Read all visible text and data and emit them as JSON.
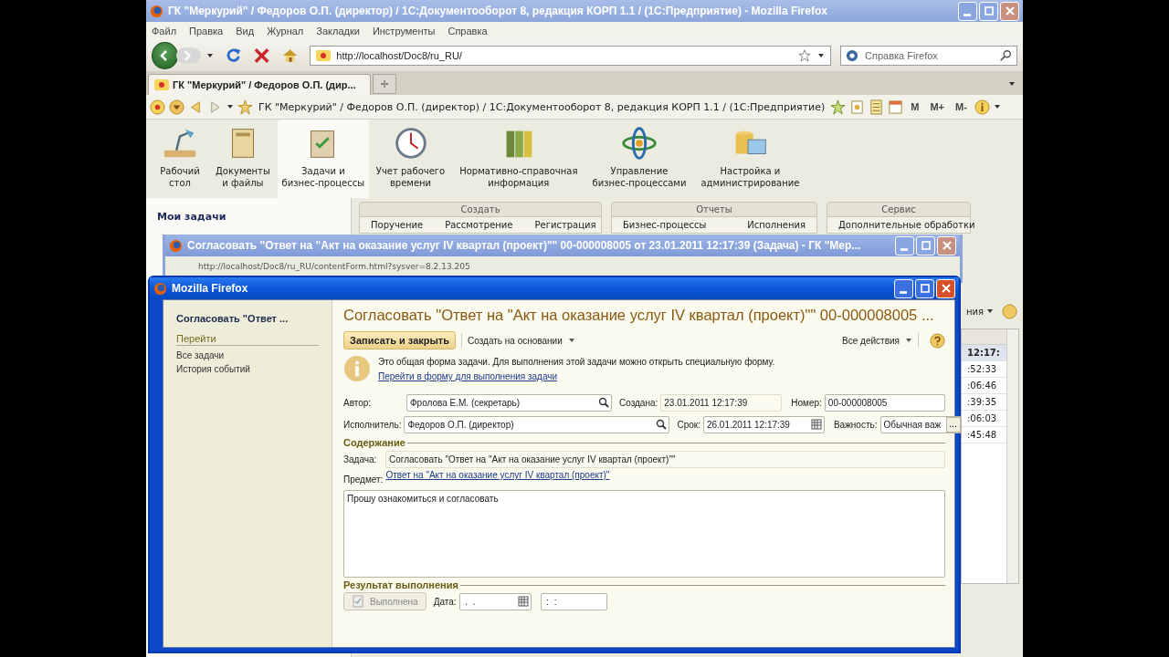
{
  "browser": {
    "title": "ГК \"Меркурий\" / Федоров О.П. (директор) / 1С:Документооборот 8, редакция КОРП 1.1 / (1С:Предприятие) - Mozilla Firefox",
    "menu": [
      "Файл",
      "Правка",
      "Вид",
      "Журнал",
      "Закладки",
      "Инструменты",
      "Справка"
    ],
    "address": "http://localhost/Doc8/ru_RU/",
    "search": {
      "placeholder": "Справка Firefox"
    },
    "tabs": [
      {
        "label": "ГК \"Меркурий\" / Федоров О.П. (дир...",
        "selected": true
      }
    ],
    "new_tab": "✛"
  },
  "app": {
    "path": "ГК \"Меркурий\" / Федоров О.П. (директор) / 1С:Документооборот 8, редакция КОРП 1.1 / (1С:Предприятие)",
    "memory_buttons": [
      "M",
      "M+",
      "M-"
    ],
    "sections": [
      {
        "label": "Рабочий\nстол",
        "selected": false
      },
      {
        "label": "Документы\nи файлы",
        "selected": false
      },
      {
        "label": "Задачи и\nбизнес-процессы",
        "selected": true
      },
      {
        "label": "Учет рабочего\nвремени",
        "selected": false
      },
      {
        "label": "Нормативно-справочная\nинформация",
        "selected": false
      },
      {
        "label": "Управление\nбизнес-процессами",
        "selected": false
      },
      {
        "label": "Настройка и\nадминистрирование",
        "selected": false
      }
    ],
    "nav": {
      "title": "Мои задачи"
    },
    "command_groups": [
      {
        "title": "Создать",
        "items": [
          "Поручение",
          "Рассмотрение",
          "Регистрация"
        ]
      },
      {
        "title": "Отчеты",
        "items": [
          "Бизнес-процессы",
          "Исполнения"
        ]
      },
      {
        "title": "Сервис",
        "items": [
          "Дополнительные обработки"
        ]
      }
    ],
    "list": {
      "header": "ния",
      "times": [
        {
          "text": "12:17:",
          "selected": true
        },
        {
          "text": ":52:33",
          "selected": false
        },
        {
          "text": ":06:46",
          "selected": false
        },
        {
          "text": ":39:35",
          "selected": false
        },
        {
          "text": ":06:03",
          "selected": false
        },
        {
          "text": ":45:48",
          "selected": false
        }
      ]
    }
  },
  "background_window": {
    "title": "Согласовать \"Ответ на \"Акт на оказание услуг IV квартал (проект)\"\" 00-000008005 от 23.01.2011 12:17:39 (Задача) - ГК \"Мер...",
    "address": "http://localhost/Doc8/ru_RU/contentForm.html?sysver=8.2.13.205"
  },
  "dialog": {
    "title": "Mozilla Firefox",
    "sidebar": {
      "heading": "Согласовать \"Ответ ...",
      "group": "Перейти",
      "links": [
        "Все задачи",
        "История событий"
      ]
    },
    "form_title": "Согласовать \"Ответ на \"Акт на оказание услуг IV квартал (проект)\"\" 00-000008005 ...",
    "toolbar": {
      "primary": "Записать и закрыть",
      "create_based": "Создать на основании",
      "all_actions": "Все действия"
    },
    "notice": {
      "text": "Это общая форма задачи. Для выполнения этой задачи можно открыть специальную форму.",
      "link": "Перейти в форму для выполнения задачи"
    },
    "author": {
      "label": "Автор:",
      "value": "Фролова Е.М. (секретарь)"
    },
    "created": {
      "label": "Создана:",
      "value": "23.01.2011 12:17:39"
    },
    "number": {
      "label": "Номер:",
      "value": "00-000008005"
    },
    "performer": {
      "label": "Исполнитель:",
      "value": "Федоров О.П. (директор)"
    },
    "due": {
      "label": "Срок:",
      "value": "26.01.2011 12:17:39"
    },
    "importance": {
      "label": "Важность:",
      "value": "Обычная важ",
      "more": "..."
    },
    "content_section": "Содержание",
    "task": {
      "label": "Задача:",
      "value": "Согласовать \"Ответ на \"Акт на оказание услуг IV квартал (проект)\"\""
    },
    "subject": {
      "label": "Предмет:",
      "link": "Ответ на \"Акт на оказание услуг IV квартал (проект)\""
    },
    "comment": "Прошу ознакомиться и согласовать",
    "result_section": "Результат выполнения",
    "done_button": {
      "label": "Выполнена",
      "disabled": true
    },
    "date": {
      "label": "Дата:",
      "value": " .  . "
    },
    "time_value": " :  : "
  }
}
